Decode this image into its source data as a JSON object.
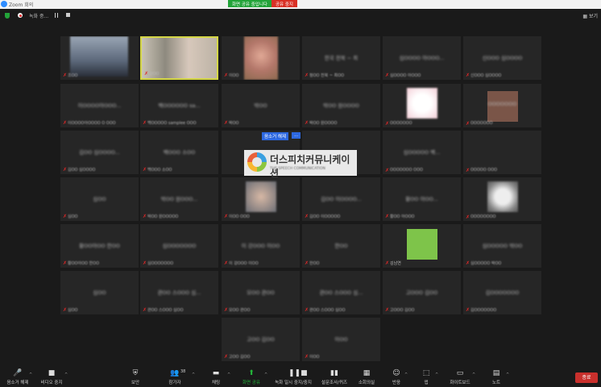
{
  "window": {
    "title": "Zoom 회의"
  },
  "share_banner": {
    "status": "화면 공유 중입니다",
    "stop_label": "공유 중지"
  },
  "top_bar": {
    "recording": "녹화 중...",
    "view_label": "보기"
  },
  "overlays": {
    "unmute_popup": "음소거 해제",
    "more_popup": "...",
    "logo_name": "더스피치커뮤니케이션",
    "logo_subtitle": "THE SPEECH COMMUNICATION"
  },
  "tiles": [
    {
      "name": "",
      "label": "조OO"
    },
    {
      "name": "",
      "label": "강OO"
    },
    {
      "name": "",
      "label": "이OO"
    },
    {
      "name": "한국 전북 ~ 최",
      "label": "정OO 전북 ~ 최OO"
    },
    {
      "name": "심OOOO 아OOO...",
      "label": "심OOOO 아OOO"
    },
    {
      "name": "신OOO 심OOOO",
      "label": "신OOO 심OOOO"
    },
    {
      "name": "이OOOO아OOO...",
      "label": "이OOOO아OOOO O OOO"
    },
    {
      "name": "백OOOOOO sa...",
      "label": "백OOOOO samplee OOO"
    },
    {
      "name": "박OO",
      "label": "박OO"
    },
    {
      "name": "박OO 원OOOO",
      "label": "박OO 원OOOO"
    },
    {
      "name": "",
      "label": "OOOOOOO"
    },
    {
      "name": "OOOOOOO",
      "label": "OOOOOOO"
    },
    {
      "name": "김OO 심OOOO...",
      "label": "김OO 심OOOO"
    },
    {
      "name": "백OOO 소OO",
      "label": "백OOO 소OO"
    },
    {
      "name": "",
      "label": ""
    },
    {
      "name": "",
      "label": ""
    },
    {
      "name": "심OOOOO 백...",
      "label": "OOOOOOO OOO"
    },
    {
      "name": "",
      "label": "OOOOO OOO"
    },
    {
      "name": "심OO",
      "label": "심OO"
    },
    {
      "name": "박OO 원OOO...",
      "label": "박OO 원OOOOO"
    },
    {
      "name": "",
      "label": "이OO OOO"
    },
    {
      "name": "김OO 이OOOO...",
      "label": "김OO 이OOOOO"
    },
    {
      "name": "황OO 아OO...",
      "label": "황OO 아OOO"
    },
    {
      "name": "",
      "label": "OOOOOOOO"
    },
    {
      "name": "황OO아OO 한OO",
      "label": "황OO아OO 한OO"
    },
    {
      "name": "심OOOOOOO",
      "label": "심OOOOOOO"
    },
    {
      "name": "이 강OOO 이OO",
      "label": "이 강OOO 이OO"
    },
    {
      "name": "한OO",
      "label": "한OO"
    },
    {
      "name": "",
      "label": "김남연"
    },
    {
      "name": "심OOOOO 박OO",
      "label": "심OOOOO 박OO"
    },
    {
      "name": "심OO",
      "label": "심OO"
    },
    {
      "name": "관OO 스OOO 심...",
      "label": "관OO 스OOO 심OO"
    },
    {
      "name": "모OO 관OO",
      "label": "모OO 관OO"
    },
    {
      "name": "관OO 스OOO 심...",
      "label": "관OO 스OOO 심OO"
    },
    {
      "name": "고OOO 김OO",
      "label": "고OOO 김OO"
    },
    {
      "name": "김OOOOOOO",
      "label": "김OOOOOOO"
    },
    {
      "name": "고OO 김OO",
      "label": "고OO 김OO"
    },
    {
      "name": "이OO",
      "label": "이OO"
    }
  ],
  "toolbar": {
    "unmute": "음소거 해제",
    "stop_video": "비디오 중지",
    "security": "보안",
    "participants": "참가자",
    "participants_count": "38",
    "chat": "채팅",
    "share_screen": "화면 공유",
    "pause_recording": "녹화 일시 중지/중지",
    "polls": "설문조사/퀴즈",
    "breakout": "소회의실",
    "reactions": "반응",
    "apps": "앱",
    "whiteboard": "화이트보드",
    "notes": "노트",
    "end": "종료"
  }
}
